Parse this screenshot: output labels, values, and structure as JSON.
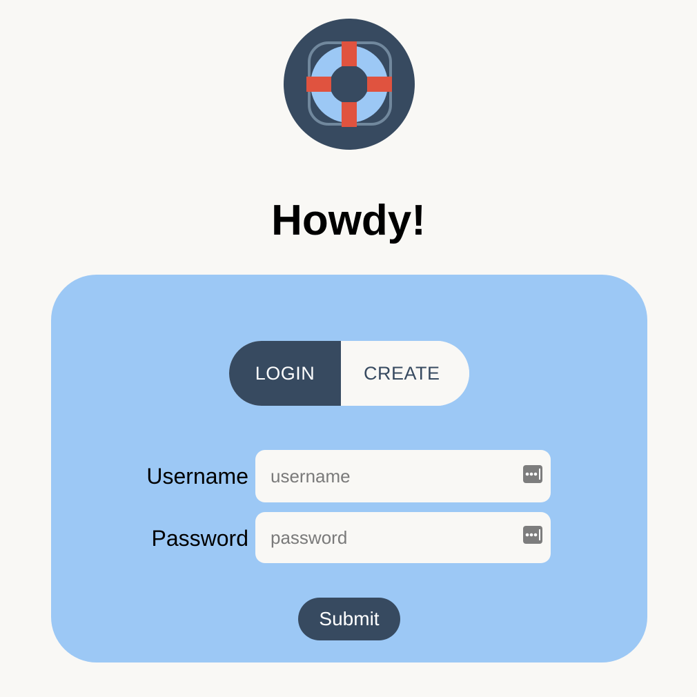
{
  "header": {
    "logo_icon": "lifebuoy-icon",
    "title": "Howdy!"
  },
  "auth_toggle": {
    "login_label": "LOGIN",
    "create_label": "CREATE",
    "active": "LOGIN"
  },
  "form": {
    "username": {
      "label": "Username",
      "value": "",
      "placeholder": "username",
      "icon": "password-manager-icon"
    },
    "password": {
      "label": "Password",
      "value": "",
      "placeholder": "password",
      "icon": "password-manager-icon"
    },
    "submit_label": "Submit"
  },
  "colors": {
    "background": "#f9f8f5",
    "card": "#9cc8f5",
    "primary": "#374a60",
    "accent_red": "#e0533f",
    "logo_ring": "#9cc8f5"
  }
}
